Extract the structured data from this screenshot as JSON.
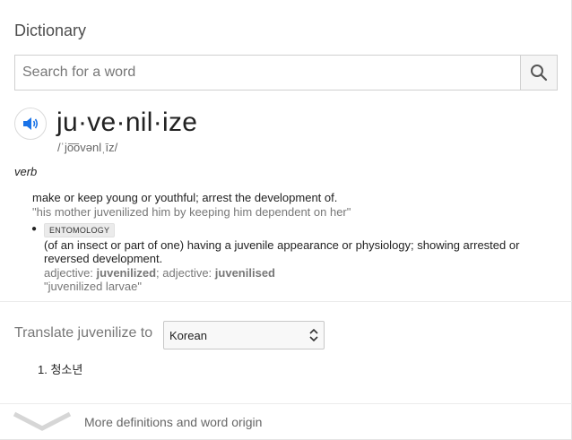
{
  "header": {
    "title": "Dictionary"
  },
  "search": {
    "placeholder": "Search for a word",
    "value": ""
  },
  "entry": {
    "word": "ju·ve·nil·ize",
    "phonetic": "/ˈjo͞ovənlˌīz/",
    "part_of_speech": "verb",
    "definitions": [
      {
        "text": "make or keep young or youthful; arrest the development of.",
        "example": "\"his mother juvenilized him by keeping him dependent on her\""
      },
      {
        "badge": "ENTOMOLOGY",
        "text": "(of an insect or part of one) having a juvenile appearance or physiology; showing arrested or reversed development.",
        "forms": [
          {
            "label": "adjective:",
            "word": "juvenilized"
          },
          {
            "label": "adjective:",
            "word": "juvenilised"
          }
        ],
        "example": "\"juvenilized larvae\""
      }
    ]
  },
  "translate": {
    "label": "Translate juvenilize to",
    "language": "Korean",
    "results": [
      "1. 청소년"
    ]
  },
  "footer": {
    "more_label": "More definitions and word origin"
  },
  "icons": {
    "speaker": "speaker-icon",
    "search": "search-icon",
    "expand": "chevron-down-icon",
    "select_arrows": "select-arrows-icon"
  },
  "colors": {
    "accent": "#1a73e8",
    "muted": "#777777"
  }
}
